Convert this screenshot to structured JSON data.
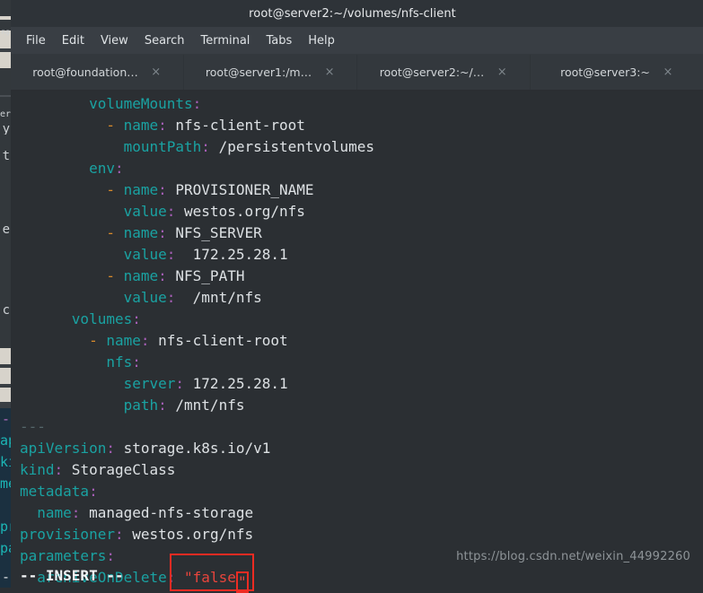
{
  "window": {
    "title": "root@server2:~/volumes/nfs-client"
  },
  "menubar": {
    "items": [
      {
        "label": "File"
      },
      {
        "label": "Edit"
      },
      {
        "label": "View"
      },
      {
        "label": "Search"
      },
      {
        "label": "Terminal"
      },
      {
        "label": "Tabs"
      },
      {
        "label": "Help"
      }
    ]
  },
  "tabs": [
    {
      "label": "root@foundation…",
      "close": "×",
      "active": false
    },
    {
      "label": "root@server1:/m…",
      "close": "×",
      "active": false
    },
    {
      "label": "root@server2:~/…",
      "close": "×",
      "active": true
    },
    {
      "label": "root@server3:~",
      "close": "×",
      "active": false
    }
  ],
  "editor": {
    "lines": [
      {
        "indent": "        ",
        "key": "volumeMounts",
        "colon": ":",
        "value": ""
      },
      {
        "indent": "          ",
        "dash": "- ",
        "key": "name",
        "colon": ":",
        "value": " nfs-client-root"
      },
      {
        "indent": "            ",
        "key": "mountPath",
        "colon": ":",
        "value": " /persistentvolumes"
      },
      {
        "indent": "        ",
        "key": "env",
        "colon": ":",
        "value": ""
      },
      {
        "indent": "          ",
        "dash": "- ",
        "key": "name",
        "colon": ":",
        "value": " PROVISIONER_NAME"
      },
      {
        "indent": "            ",
        "key": "value",
        "colon": ":",
        "value": " westos.org/nfs"
      },
      {
        "indent": "          ",
        "dash": "- ",
        "key": "name",
        "colon": ":",
        "value": " NFS_SERVER"
      },
      {
        "indent": "            ",
        "key": "value",
        "colon": ":",
        "value": "  172.25.28.1"
      },
      {
        "indent": "          ",
        "dash": "- ",
        "key": "name",
        "colon": ":",
        "value": " NFS_PATH"
      },
      {
        "indent": "            ",
        "key": "value",
        "colon": ":",
        "value": "  /mnt/nfs"
      },
      {
        "indent": "      ",
        "key": "volumes",
        "colon": ":",
        "value": ""
      },
      {
        "indent": "        ",
        "dash": "- ",
        "key": "name",
        "colon": ":",
        "value": " nfs-client-root"
      },
      {
        "indent": "          ",
        "key": "nfs",
        "colon": ":",
        "value": ""
      },
      {
        "indent": "            ",
        "key": "server",
        "colon": ":",
        "value": " 172.25.28.1"
      },
      {
        "indent": "            ",
        "key": "path",
        "colon": ":",
        "value": " /mnt/nfs"
      },
      {
        "indent": "",
        "separator": "---"
      },
      {
        "indent": "",
        "key": "apiVersion",
        "colon": ":",
        "value": " storage.k8s.io/v1"
      },
      {
        "indent": "",
        "key": "kind",
        "colon": ":",
        "value": " StorageClass"
      },
      {
        "indent": "",
        "key": "metadata",
        "colon": ":",
        "value": ""
      },
      {
        "indent": "  ",
        "key": "name",
        "colon": ":",
        "value": " managed-nfs-storage"
      },
      {
        "indent": "",
        "key": "provisioner",
        "colon": ":",
        "value": " westos.org/nfs"
      },
      {
        "indent": "",
        "key": "parameters",
        "colon": ":",
        "value": ""
      },
      {
        "indent": "  ",
        "key": "archiveOnDelete",
        "colon": ":",
        "string_prefix": " \"false",
        "cursor_char": "\""
      }
    ]
  },
  "status": {
    "mode": "-- INSERT --"
  },
  "watermark": {
    "text": "https://blog.csdn.net/weixin_44992260"
  },
  "annotation": {
    "label": "archiveOnDelete-value-highlight"
  },
  "colors": {
    "terminal_bg": "#2b2f33",
    "titlebar_bg": "#2e3338",
    "menubar_bg": "#393e44",
    "tabbar_bg": "#33383d",
    "key": "#1aa2a2",
    "colon": "#a85fb8",
    "dash": "#d98b2b",
    "value": "#dde1e4",
    "string": "#e8453c",
    "separator": "#55666a",
    "annotation": "#ee2b22"
  }
}
